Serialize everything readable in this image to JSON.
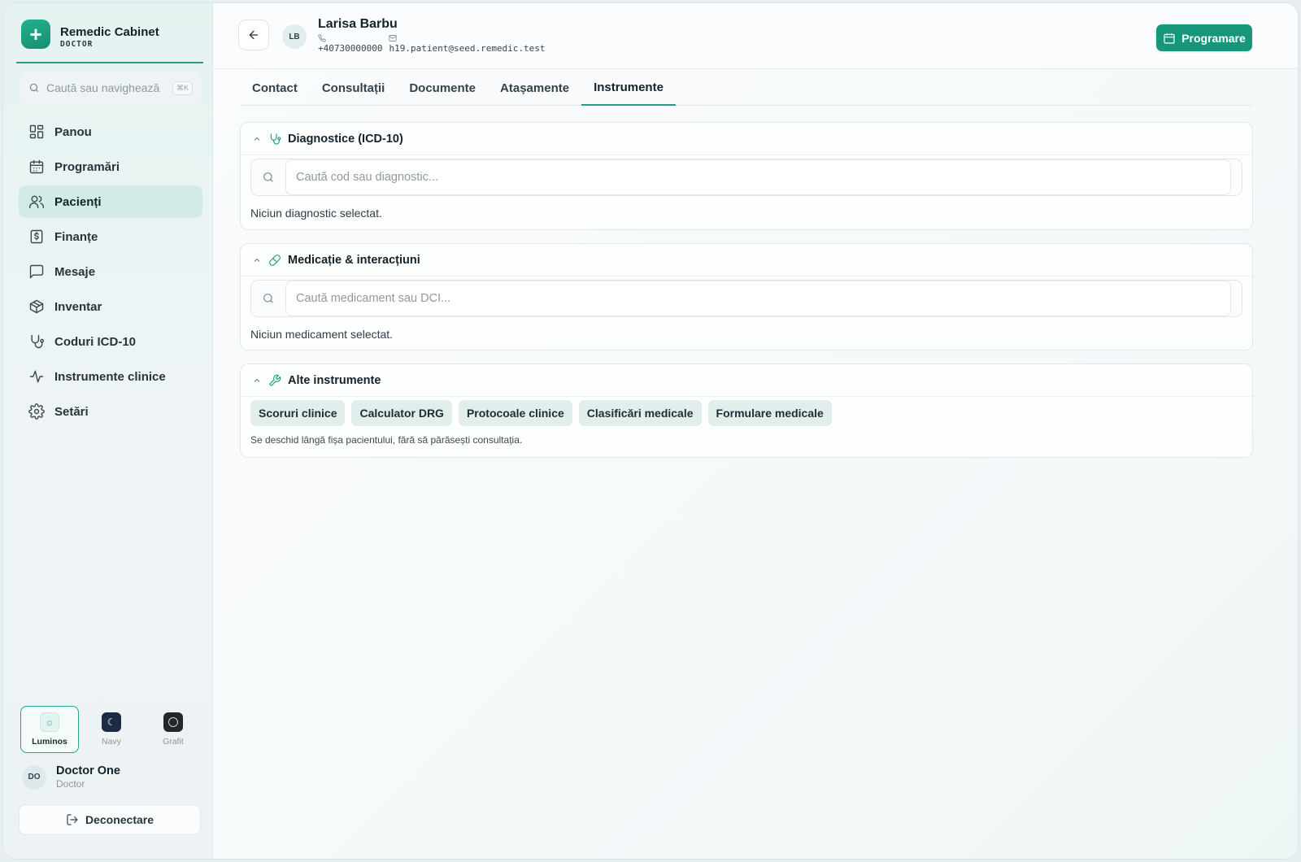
{
  "sidebar": {
    "brand_name": "Remedic Cabinet",
    "brand_role": "DOCTOR",
    "search_placeholder": "Caută sau navighează",
    "search_shortcut": "⌘K",
    "items": [
      {
        "label": "Panou",
        "icon": "dashboard-icon"
      },
      {
        "label": "Programări",
        "icon": "calendar-icon"
      },
      {
        "label": "Pacienți",
        "icon": "users-icon",
        "active": true
      },
      {
        "label": "Finanțe",
        "icon": "dollar-receipt-icon"
      },
      {
        "label": "Mesaje",
        "icon": "message-icon"
      },
      {
        "label": "Inventar",
        "icon": "package-icon"
      },
      {
        "label": "Coduri ICD-10",
        "icon": "stethoscope-icon"
      },
      {
        "label": "Instrumente clinice",
        "icon": "activity-icon"
      },
      {
        "label": "Setări",
        "icon": "gear-icon"
      }
    ],
    "themes": [
      {
        "label": "Luminos",
        "active": true
      },
      {
        "label": "Navy"
      },
      {
        "label": "Grafit"
      }
    ],
    "user": {
      "initials": "DO",
      "name": "Doctor One",
      "role": "Doctor"
    },
    "logout_label": "Deconectare"
  },
  "header": {
    "patient_initials": "LB",
    "patient_name": "Larisa Barbu",
    "phone": "+40730000000",
    "email": "h19.patient@seed.remedic.test",
    "appointment_button": "Programare"
  },
  "tabs": [
    "Contact",
    "Consultații",
    "Documente",
    "Atașamente",
    "Instrumente"
  ],
  "active_tab": "Instrumente",
  "sections": {
    "diagnostics": {
      "title": "Diagnostice (ICD-10)",
      "placeholder": "Caută cod sau diagnostic...",
      "empty": "Niciun diagnostic selectat."
    },
    "medication": {
      "title": "Medicație & interacțiuni",
      "placeholder": "Caută medicament sau DCI...",
      "empty": "Niciun medicament selectat."
    },
    "other": {
      "title": "Alte instrumente",
      "tools": [
        "Scoruri clinice",
        "Calculator DRG",
        "Protocoale clinice",
        "Clasificări medicale",
        "Formulare medicale"
      ],
      "hint": "Se deschid lângă fișa pacientului, fără să părăsești consultația."
    }
  },
  "colors": {
    "accent": "#16967a",
    "accent_light": "#d3ebe7"
  }
}
